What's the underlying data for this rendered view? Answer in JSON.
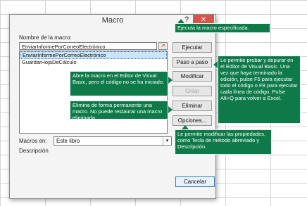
{
  "dialog": {
    "title": "Macro",
    "help": "?",
    "close": "✕",
    "name_label": "Nombre de la macro:",
    "name_value": "EnviarInformePorCorreoElectrónico",
    "browse_icon": "↗",
    "macros": [
      {
        "label": "EnviarInformePorCorreoElectrónico",
        "selected": true
      },
      {
        "label": "GuardarHojaDeCálculo",
        "selected": false
      }
    ],
    "macros_in_label": "Macros en:",
    "macros_in_value": "Este libro",
    "description_label": "Descripción",
    "buttons": {
      "run": "Ejecutar",
      "step_into": "Paso a paso",
      "edit": "Modificar",
      "create": "Crear",
      "delete": "Eliminar",
      "options": "Opciones...",
      "cancel": "Cancelar"
    }
  },
  "callouts": {
    "run": "Ejecuta la macro especificada.",
    "step_into": "Le permite probar y depurar en el Editor de Visual Basic. Una vez que haya terminado la edición, pulse F5 para ejecutar todo el código o F8 para ejecutar cada línea de código. Pulse Alt+Q para volver a Excel.",
    "edit": "Abre la macro en el Editor de Visual Basic, pero el código no se ha iniciado.",
    "delete": "Elimina de forma permanente una macro. No puede restaurar una macro eliminada.",
    "options": "Le permite modificar las propiedades, como Tecla de método abreviado y Descripción."
  },
  "colors": {
    "callout": "#0e7a4a",
    "close": "#d9534a",
    "selection": "#cce4f7"
  }
}
